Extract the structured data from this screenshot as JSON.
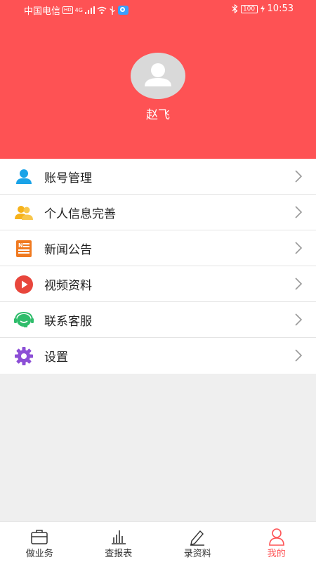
{
  "status_bar": {
    "carrier": "中国电信",
    "hd": "HD",
    "network": "4G",
    "battery": "100",
    "time": "10:53"
  },
  "profile": {
    "name": "赵飞"
  },
  "menu": [
    {
      "label": "账号管理",
      "icon": "person-icon"
    },
    {
      "label": "个人信息完善",
      "icon": "people-icon"
    },
    {
      "label": "新闻公告",
      "icon": "news-icon"
    },
    {
      "label": "视频资料",
      "icon": "video-play-icon"
    },
    {
      "label": "联系客服",
      "icon": "customer-service-icon"
    },
    {
      "label": "设置",
      "icon": "gear-icon"
    }
  ],
  "tabbar": [
    {
      "label": "做业务",
      "icon": "briefcase-icon"
    },
    {
      "label": "查报表",
      "icon": "bar-chart-icon"
    },
    {
      "label": "录资料",
      "icon": "pencil-icon"
    },
    {
      "label": "我的",
      "icon": "user-icon",
      "active": true
    }
  ],
  "colors": {
    "accent": "#fe5254",
    "background": "#efefef"
  }
}
